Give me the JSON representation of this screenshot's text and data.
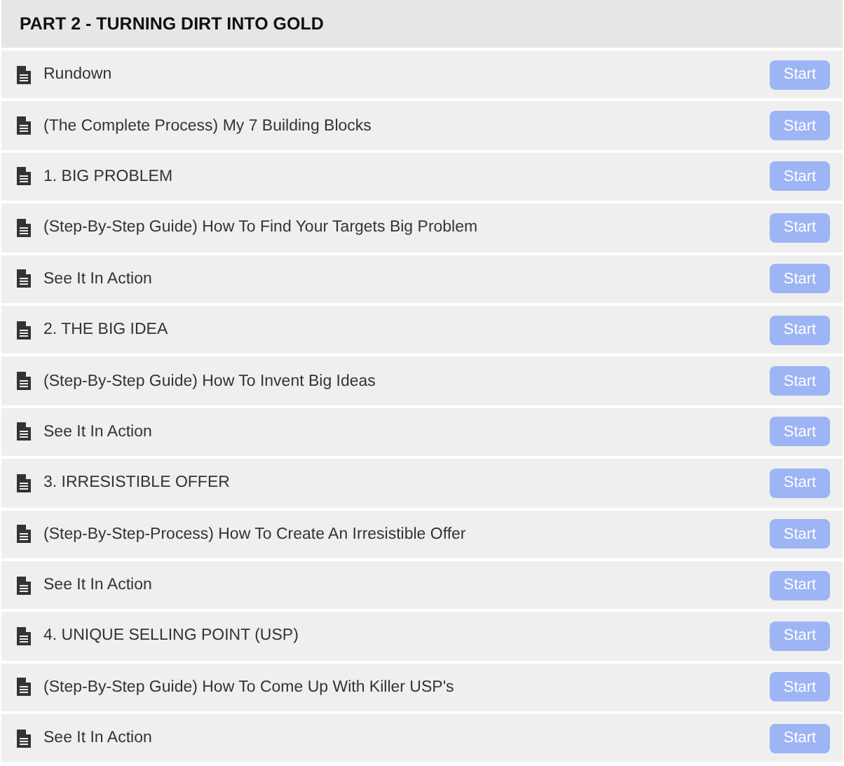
{
  "section": {
    "title": "PART 2 - TURNING DIRT INTO GOLD"
  },
  "lessons": [
    {
      "title": "Rundown",
      "button": "Start"
    },
    {
      "title": "(The Complete Process) My 7 Building Blocks",
      "button": "Start"
    },
    {
      "title": "1. BIG PROBLEM",
      "button": "Start"
    },
    {
      "title": "(Step-By-Step Guide) How To Find Your Targets Big Problem",
      "button": "Start"
    },
    {
      "title": "See It In Action",
      "button": "Start"
    },
    {
      "title": "2. THE BIG IDEA",
      "button": "Start"
    },
    {
      "title": "(Step-By-Step Guide) How To Invent Big Ideas",
      "button": "Start"
    },
    {
      "title": "See It In Action",
      "button": "Start"
    },
    {
      "title": "3. IRRESISTIBLE OFFER",
      "button": "Start"
    },
    {
      "title": "(Step-By-Step-Process) How To Create An Irresistible Offer",
      "button": "Start"
    },
    {
      "title": "See It In Action",
      "button": "Start"
    },
    {
      "title": "4. UNIQUE SELLING POINT (USP)",
      "button": "Start"
    },
    {
      "title": "(Step-By-Step Guide) How To Come Up With Killer USP's",
      "button": "Start"
    },
    {
      "title": "See It In Action",
      "button": "Start"
    }
  ]
}
